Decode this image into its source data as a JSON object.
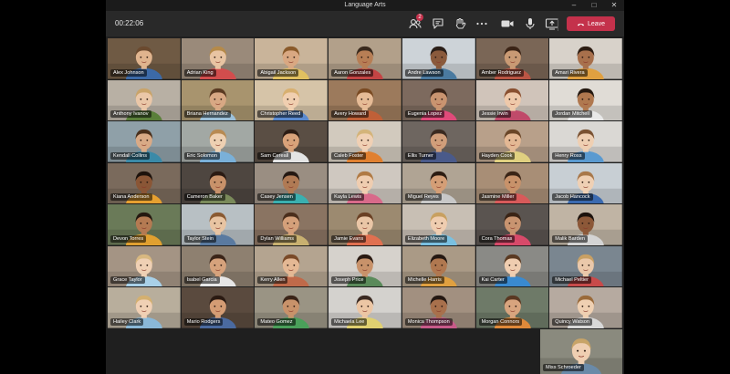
{
  "window": {
    "title": "Language Arts"
  },
  "toolbar": {
    "timer": "00:22:06",
    "participants_badge": "2",
    "leave_label": "Leave",
    "accent_color": "#c4314b"
  },
  "participants": [
    {
      "name": "Alex Johnson",
      "bg": "#6f5a44",
      "skin": "#e0b48e",
      "hair": "#6b4a2f",
      "shirt": "#3c6aa8"
    },
    {
      "name": "Adrian King",
      "bg": "#9a8a7a",
      "skin": "#e8c4a2",
      "hair": "#b58a4a",
      "shirt": "#d24d4d"
    },
    {
      "name": "Abigail Jackson",
      "bg": "#c9b49a",
      "skin": "#d9a882",
      "hair": "#8a5a2a",
      "shirt": "#e0c060"
    },
    {
      "name": "Aaron Gonzales",
      "bg": "#b2a08a",
      "skin": "#b77e55",
      "hair": "#3a2a1e",
      "shirt": "#c44444"
    },
    {
      "name": "Andre Lawson",
      "bg": "#cdd3d8",
      "skin": "#8a5a3c",
      "hair": "#2a1e18",
      "shirt": "#4a7aa0"
    },
    {
      "name": "Amber Rodriguez",
      "bg": "#7a6656",
      "skin": "#c99a74",
      "hair": "#3b2416",
      "shirt": "#bb5544"
    },
    {
      "name": "Amari Rivera",
      "bg": "#d8d2ca",
      "skin": "#a8704c",
      "hair": "#2c1c12",
      "shirt": "#e0a040"
    },
    {
      "name": "Anthony Ivanov",
      "bg": "#b8b0a4",
      "skin": "#eac7a8",
      "hair": "#c9a46a",
      "shirt": "#5a7f3a"
    },
    {
      "name": "Briana Hernandez",
      "bg": "#a8946e",
      "skin": "#d8a884",
      "hair": "#5a3a22",
      "shirt": "#9cc0d8"
    },
    {
      "name": "Christopher Reed",
      "bg": "#d6c4a8",
      "skin": "#f0cfb0",
      "hair": "#d8b070",
      "shirt": "#5a8ad0"
    },
    {
      "name": "Avery Howard",
      "bg": "#9c7a5c",
      "skin": "#e6bb96",
      "hair": "#7a4a22",
      "shirt": "#c06038"
    },
    {
      "name": "Eugenia Lopez",
      "bg": "#7d6a5e",
      "skin": "#c99470",
      "hair": "#3a2418",
      "shirt": "#e04a7a"
    },
    {
      "name": "Jessie Irwin",
      "bg": "#d0c4ba",
      "skin": "#efc9aa",
      "hair": "#8a5030",
      "shirt": "#c04a6a"
    },
    {
      "name": "Jordan Mitchell",
      "bg": "#e0dcd6",
      "skin": "#b0784f",
      "hair": "#241810",
      "shirt": "#e8e8e8"
    },
    {
      "name": "Kendall Collins",
      "bg": "#8fa0a8",
      "skin": "#d9aa86",
      "hair": "#4a301c",
      "shirt": "#3a8aa8"
    },
    {
      "name": "Eric Solomon",
      "bg": "#a2a8a4",
      "skin": "#eed0b2",
      "hair": "#b88a52",
      "shirt": "#7ab0d8"
    },
    {
      "name": "Sam Cereall",
      "bg": "#5a4e44",
      "skin": "#d8a27a",
      "hair": "#2c1c14",
      "shirt": "#e4e4e4"
    },
    {
      "name": "Caleb Foster",
      "bg": "#d2cabe",
      "skin": "#f0d0b4",
      "hair": "#d4b47a",
      "shirt": "#e08030"
    },
    {
      "name": "Ellis Turner",
      "bg": "#6e6660",
      "skin": "#d09e7a",
      "hair": "#3a2a20",
      "shirt": "#4a5a8a"
    },
    {
      "name": "Hayden Cook",
      "bg": "#b8a08a",
      "skin": "#e4b894",
      "hair": "#6a4628",
      "shirt": "#e0d080"
    },
    {
      "name": "Henry Ross",
      "bg": "#dad8d4",
      "skin": "#efcfb2",
      "hair": "#7a5232",
      "shirt": "#5a9ad0"
    },
    {
      "name": "Kiana Anderson",
      "bg": "#7a6a5c",
      "skin": "#8a5636",
      "hair": "#1c120c",
      "shirt": "#e6a030"
    },
    {
      "name": "Cameron Baker",
      "bg": "#4e4640",
      "skin": "#c8926a",
      "hair": "#2a1a12",
      "shirt": "#7a8a5a"
    },
    {
      "name": "Casey Jensen",
      "bg": "#9a8e82",
      "skin": "#b07a54",
      "hair": "#241812",
      "shirt": "#3ab0b0"
    },
    {
      "name": "Kayla Lewis",
      "bg": "#cfc8c0",
      "skin": "#efcdb0",
      "hair": "#b07a44",
      "shirt": "#d86a8a"
    },
    {
      "name": "Miguel Reyes",
      "bg": "#b0a494",
      "skin": "#d49e76",
      "hair": "#2c1c12",
      "shirt": "#c8c8c8"
    },
    {
      "name": "Jasmine Miller",
      "bg": "#a88e76",
      "skin": "#c8926a",
      "hair": "#3a2416",
      "shirt": "#d85a5a"
    },
    {
      "name": "Jacob Hancock",
      "bg": "#c8cfd4",
      "skin": "#efd0b4",
      "hair": "#a8784a",
      "shirt": "#3a6ab0"
    },
    {
      "name": "Devon Torres",
      "bg": "#6a7a58",
      "skin": "#b47a52",
      "hair": "#241810",
      "shirt": "#e0a030"
    },
    {
      "name": "Taylor Stein",
      "bg": "#b8c0c4",
      "skin": "#e8c4a2",
      "hair": "#8a5a32",
      "shirt": "#5a7aa0"
    },
    {
      "name": "Dylan Williams",
      "bg": "#8a7462",
      "skin": "#d4a07a",
      "hair": "#4a2e1c",
      "shirt": "#c8b070"
    },
    {
      "name": "Jamie Evans",
      "bg": "#9c8a70",
      "skin": "#eac6a6",
      "hair": "#6a4024",
      "shirt": "#e07050"
    },
    {
      "name": "Elizabeth Moore",
      "bg": "#c8bfb4",
      "skin": "#efcdb0",
      "hair": "#c8a060",
      "shirt": "#7ac0e0"
    },
    {
      "name": "Cora Thomas",
      "bg": "#5a5450",
      "skin": "#c89470",
      "hair": "#3a2416",
      "shirt": "#d84a6a"
    },
    {
      "name": "Malik Barden",
      "bg": "#c0b4a4",
      "skin": "#8c5838",
      "hair": "#1c120c",
      "shirt": "#d4d4d4"
    },
    {
      "name": "Grace Taylor",
      "bg": "#a49484",
      "skin": "#efd0b4",
      "hair": "#d8b880",
      "shirt": "#a8d0e8"
    },
    {
      "name": "Isabel Garcia",
      "bg": "#8e8070",
      "skin": "#d6a27c",
      "hair": "#3a2418",
      "shirt": "#e6e6e6"
    },
    {
      "name": "Kerry Allen",
      "bg": "#b4a490",
      "skin": "#e4b894",
      "hair": "#7a4a28",
      "shirt": "#c06a4a"
    },
    {
      "name": "Joseph Price",
      "bg": "#d6d2cc",
      "skin": "#c8926a",
      "hair": "#2a1a12",
      "shirt": "#5a8a5a"
    },
    {
      "name": "Michelle Harris",
      "bg": "#aa9a86",
      "skin": "#b07850",
      "hair": "#241812",
      "shirt": "#e0a040"
    },
    {
      "name": "Kai Carter",
      "bg": "#8a8a86",
      "skin": "#efcdb0",
      "hair": "#5a3a22",
      "shirt": "#3a8ad0"
    },
    {
      "name": "Michael Peltier",
      "bg": "#7a8690",
      "skin": "#eac8aa",
      "hair": "#c8a064",
      "shirt": "#c84a4a"
    },
    {
      "name": "Hailey Clark",
      "bg": "#b8ae9c",
      "skin": "#f0d0b4",
      "hair": "#d4b070",
      "shirt": "#8ab8d8"
    },
    {
      "name": "Mario Rodgers",
      "bg": "#5a4a3e",
      "skin": "#d49c74",
      "hair": "#2a1a12",
      "shirt": "#4a6aa0"
    },
    {
      "name": "Mateo Gomez",
      "bg": "#9a9484",
      "skin": "#c8926a",
      "hair": "#3a2418",
      "shirt": "#4aa05a"
    },
    {
      "name": "Michaela Lee",
      "bg": "#d4d2ce",
      "skin": "#ecc6a4",
      "hair": "#3a2a22",
      "shirt": "#e0d070"
    },
    {
      "name": "Monica Thompson",
      "bg": "#a29080",
      "skin": "#a8704c",
      "hair": "#241812",
      "shirt": "#c85a8a"
    },
    {
      "name": "Morgan Connors",
      "bg": "#6e7a68",
      "skin": "#d8a47e",
      "hair": "#5a3822",
      "shirt": "#e08a3a"
    },
    {
      "name": "Quincy Watson",
      "bg": "#b6aaa0",
      "skin": "#efd0b2",
      "hair": "#9a6a3a",
      "shirt": "#d8d8d8"
    }
  ],
  "self_view": {
    "name": "Miss Schroeder",
    "bg": "#8a8a7e",
    "skin": "#efcfb2",
    "hair": "#c8a468",
    "shirt": "#6a8aa8"
  }
}
